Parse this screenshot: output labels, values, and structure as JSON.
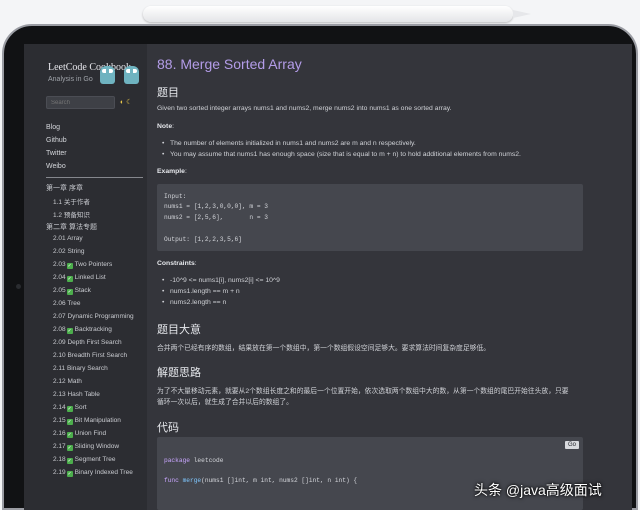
{
  "sidebar": {
    "title": "LeetCode Cookbook",
    "subtitle": "Analysis in Go",
    "search_placeholder": "Search",
    "theme_icons": "◐ ☾",
    "links": [
      "Blog",
      "Github",
      "Twitter",
      "Weibo"
    ],
    "chapters": [
      {
        "label": "第一章 序章",
        "items": [
          {
            "label": "1.1 关于作者",
            "done": false
          },
          {
            "label": "1.2 预备知识",
            "done": false
          }
        ]
      },
      {
        "label": "第二章 算法专题",
        "items": [
          {
            "label": "2.01 Array",
            "done": false
          },
          {
            "label": "2.02 String",
            "done": false
          },
          {
            "label": "2.03",
            "suffix": "Two Pointers",
            "done": true
          },
          {
            "label": "2.04",
            "suffix": "Linked List",
            "done": true
          },
          {
            "label": "2.05",
            "suffix": "Stack",
            "done": true
          },
          {
            "label": "2.06 Tree",
            "done": false
          },
          {
            "label": "2.07 Dynamic Programming",
            "done": false
          },
          {
            "label": "2.08",
            "suffix": "Backtracking",
            "done": true
          },
          {
            "label": "2.09 Depth First Search",
            "done": false
          },
          {
            "label": "2.10 Breadth First Search",
            "done": false
          },
          {
            "label": "2.11 Binary Search",
            "done": false
          },
          {
            "label": "2.12 Math",
            "done": false
          },
          {
            "label": "2.13 Hash Table",
            "done": false
          },
          {
            "label": "2.14",
            "suffix": "Sort",
            "done": true
          },
          {
            "label": "2.15",
            "suffix": "Bit Manipulation",
            "done": true
          },
          {
            "label": "2.16",
            "suffix": "Union Find",
            "done": true
          },
          {
            "label": "2.17",
            "suffix": "Sliding Window",
            "done": true
          },
          {
            "label": "2.18",
            "suffix": "Segment Tree",
            "done": true
          },
          {
            "label": "2.19",
            "suffix": "Binary Indexed Tree",
            "done": true
          }
        ]
      }
    ]
  },
  "main": {
    "title": "88. Merge Sorted Array",
    "section_problem": "题目",
    "problem_text": "Given two sorted integer arrays nums1 and nums2, merge nums2 into nums1 as one sorted array.",
    "note_label": "Note",
    "note_suffix": ":",
    "notes": [
      "The number of elements initialized in nums1 and nums2 are m and n respectively.",
      "You may assume that nums1 has enough space (size that is equal to m + n) to hold additional elements from nums2."
    ],
    "example_label": "Example",
    "example_suffix": ":",
    "example_lines": [
      "Input:",
      "nums1 = [1,2,3,0,0,0], m = 3",
      "nums2 = [2,5,6],       n = 3",
      "",
      "Output: [1,2,2,3,5,6]"
    ],
    "constraints_label": "Constraints",
    "constraints_suffix": ":",
    "constraints": [
      "-10^9 <= nums1[i], nums2[i] <= 10^9",
      "nums1.length == m + n",
      "nums2.length == n"
    ],
    "section_summary": "题目大意",
    "summary_text": "合并两个已经有序的数组，结果放在第一个数组中，第一个数组假设空间足够大。要求算法时间复杂度足够低。",
    "section_approach": "解题思路",
    "approach_lines": [
      "为了不大量移动元素，就要从2个数组长度之和的最后一个位置开始，依次选取两个数组中大的数，从第一个数组的尾巴开始往头放，只要",
      "循环一次以后，就生成了合并以后的数组了。"
    ],
    "section_code": "代码",
    "code_button": "Go",
    "code_package_kw": "package",
    "code_package_name": "leetcode",
    "code_func_kw": "func",
    "code_func_name": "merge",
    "code_func_rest": "(nums1 []int, m int, nums2 []int, n int) {"
  },
  "watermark": "头条 @java高级面试"
}
